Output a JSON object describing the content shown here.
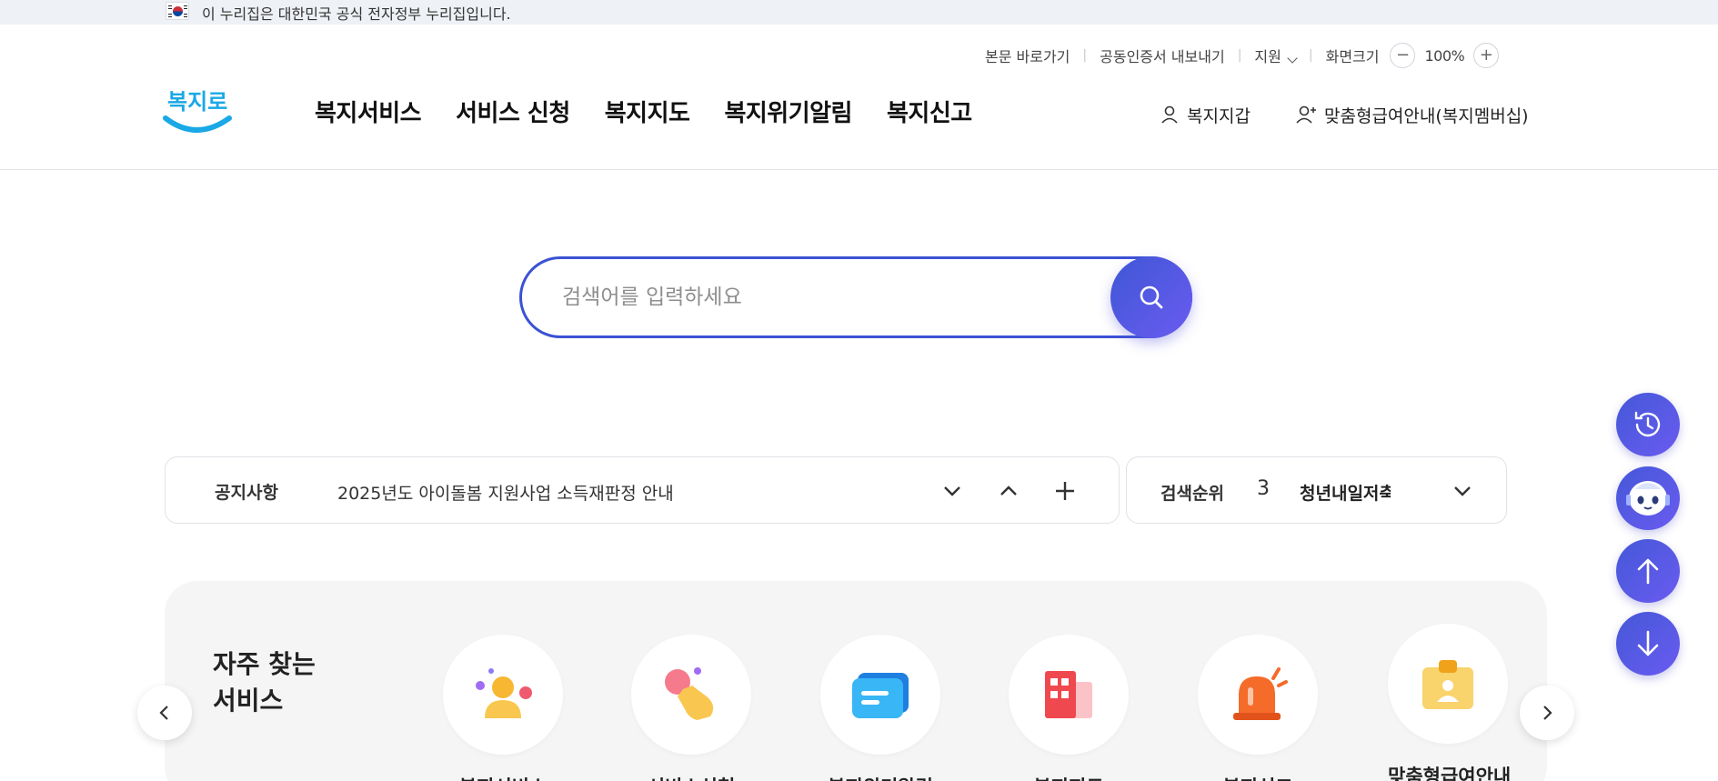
{
  "gov_banner": {
    "text": "이 누리집은 대한민국 공식 전자정부 누리집입니다."
  },
  "utility": {
    "skip": "본문 바로가기",
    "cert": "공동인증서 내보내기",
    "support": "지원",
    "zoom_label": "화면크기",
    "zoom_value": "100%"
  },
  "logo": {
    "text": "복지로"
  },
  "gnb": {
    "items": [
      {
        "label": "복지서비스"
      },
      {
        "label": "서비스 신청"
      },
      {
        "label": "복지지도"
      },
      {
        "label": "복지위기알림"
      },
      {
        "label": "복지신고"
      }
    ]
  },
  "user": {
    "wallet": "복지지갑",
    "membership": "맞춤형급여안내(복지멤버십)"
  },
  "search": {
    "placeholder": "검색어를 입력하세요"
  },
  "notice": {
    "label": "공지사항",
    "text": "2025년도 아이돌봄 지원사업 소득재판정 안내"
  },
  "rank": {
    "label": "검색순위",
    "number": "3",
    "keyword": "청년내일저축계좌"
  },
  "frequent": {
    "title_line1": "자주 찾는",
    "title_line2": "서비스",
    "items": [
      {
        "label": "복지서비스",
        "icon": "people-icon"
      },
      {
        "label": "서비스신청",
        "icon": "hand-tap-icon"
      },
      {
        "label": "복지위기알림",
        "icon": "message-icon"
      },
      {
        "label": "복지지도",
        "icon": "map-building-icon"
      },
      {
        "label": "복지신고",
        "icon": "siren-icon"
      },
      {
        "label": "맞춤형급여안내",
        "icon": "id-badge-icon"
      }
    ]
  },
  "colors": {
    "primary": "#3b52d4",
    "accent": "#6a5bf0",
    "logo_blue": "#1aa8e6"
  }
}
